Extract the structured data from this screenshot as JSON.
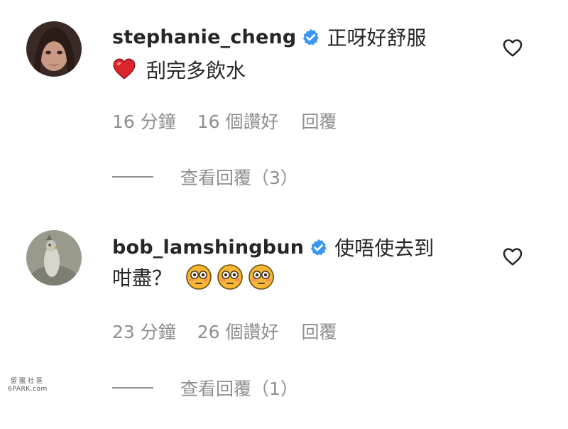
{
  "comments": [
    {
      "username": "stephanie_cheng",
      "verified": true,
      "text_line1": "正呀好舒服",
      "text_line2": "刮完多飲水",
      "time": "16 分鐘",
      "likes": "16 個讚好",
      "reply_label": "回覆",
      "view_replies": "查看回覆（3）",
      "emoji_line2": [
        "red-heart"
      ],
      "like_icon": "heart-outline-icon"
    },
    {
      "username": "bob_lamshingbun",
      "verified": true,
      "text_line1": "使唔使去到",
      "text_line2": "咁盡？",
      "time": "23 分鐘",
      "likes": "26 個讚好",
      "reply_label": "回覆",
      "view_replies": "查看回覆（1）",
      "emoji_line2": [
        "flushed-face",
        "flushed-face",
        "flushed-face"
      ],
      "like_icon": "heart-outline-icon"
    }
  ],
  "watermark": {
    "line1": "留園社區",
    "line2": "6PARK.com"
  },
  "colors": {
    "text": "#262626",
    "secondary": "#8e8e8e",
    "verified_badge": "#3897f0",
    "heart_emoji": "#d9252b",
    "flushed_emoji": "#f7b733"
  }
}
